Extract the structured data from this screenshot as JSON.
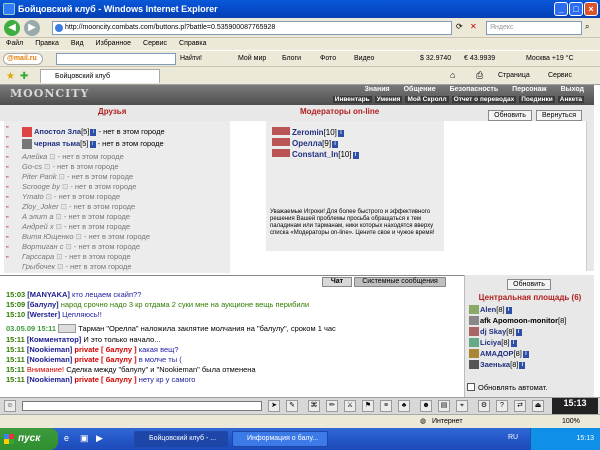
{
  "window": {
    "title": "Бойцовский клуб - Windows Internet Explorer",
    "url": "http://mooncity.combats.com/buttons.pl?battle=0.535900087765928",
    "search_placeholder": "Яндекс"
  },
  "menu": [
    "Файл",
    "Правка",
    "Вид",
    "Избранное",
    "Сервис",
    "Справка"
  ],
  "mailbar": {
    "logo": "@mail.ru",
    "find": "Найти!",
    "items": [
      "Мой мир",
      "Блоги",
      "Фото",
      "Видео"
    ],
    "usd": "$ 32.9740",
    "eur": "€ 43.9939",
    "weather": "Москва +19 °C"
  },
  "favbar": {
    "tab": "Бойцовский клуб",
    "page": "Страница",
    "tools": "Сервис"
  },
  "game": {
    "logo": "MOONCITY",
    "nav_top": [
      "Знания",
      "Общение",
      "Безопасность",
      "Персонаж",
      "Выход"
    ],
    "nav_sub": [
      "Инвентарь",
      "Умения",
      "Мой Скролл",
      "Отчет о переводах",
      "Поединки",
      "Анкета"
    ],
    "friends_title": "Друзья",
    "mods_title": "Модераторы on-line",
    "refresh": "Обновить",
    "back": "Вернуться",
    "friends_online": [
      {
        "name": "Апостол Зла",
        "level": "[5]",
        "status": " - нет в этом городе"
      },
      {
        "name": "черная тьма",
        "level": "[5]",
        "status": " - нет в этом городе"
      }
    ],
    "friends_offline": [
      {
        "name": "Алейка",
        "status": " - нет в этом городе"
      },
      {
        "name": "Go-cs",
        "status": " - нет в этом городе"
      },
      {
        "name": "Piter Pank",
        "status": " - нет в этом городе"
      },
      {
        "name": "Scrooge by",
        "status": " - нет в этом городе"
      },
      {
        "name": "Ymato",
        "status": " - нет в этом городе"
      },
      {
        "name": "Zloy_Joker",
        "status": " - нет в этом городе"
      },
      {
        "name": "А элит а",
        "status": " - нет в этом городе"
      },
      {
        "name": "Андрей х",
        "status": " - нет в этом городе"
      },
      {
        "name": "Витя Ющенко",
        "status": " - нет в этом городе"
      },
      {
        "name": "Вортиган с",
        "status": " - нет в этом городе"
      },
      {
        "name": "Гарссара",
        "status": " - нет в этом городе"
      },
      {
        "name": "Грыбочек",
        "status": " - нет в этом городе"
      }
    ],
    "moderators": [
      {
        "name": "Zeromin",
        "level": "[10]"
      },
      {
        "name": "Орелла",
        "level": "[9]"
      },
      {
        "name": "Constant_In",
        "level": "[10]"
      }
    ],
    "mod_text": "Уважаемые Игроки! Для более быстрого и эффективного решения Вашей проблемы просьба обращаться к тем паладинам или тарманам, ники которых находятся вверху списка «Модераторы on-line». Цените свое и чужое время!",
    "chat_tab": "Чат",
    "system_tab": "Системные сообщения",
    "chat": [
      {
        "time": "15:03",
        "who": "[MANYAKA]",
        "text": " кто лецаем скайп??"
      },
      {
        "time": "15:09",
        "who": "[балулу]",
        "text": " народ срочно надо 3 кр отдама 2 суки мне на аукционе вещь перибили"
      },
      {
        "time": "15:10",
        "who": "[Werster]",
        "text": " Цепляюсь!!"
      },
      {
        "time": "03.05.09 15:11",
        "text": "Тарман \"Орелла\" наложила заклятие молчания на \"балулу\", сроком 1 час"
      },
      {
        "time": "15:11",
        "who": "[Комментатор]",
        "text": " И это только начало..."
      },
      {
        "time": "15:11",
        "who": "[Nookieman]",
        "priv": " private [ балулу ]",
        "text": " какая вещ?"
      },
      {
        "time": "15:11",
        "who": "[Nookieman]",
        "priv": " private [ балулу ]",
        "text": " в молче ты ("
      },
      {
        "time": "15:11",
        "warn": "Внимание!",
        "text": " Сделка между \"балулу\" и \"Nookieman\" была отменена"
      },
      {
        "time": "15:11",
        "who": "[Nookieman]",
        "priv": " private [ балулу ]",
        "text": " нету кр у самого"
      }
    ],
    "room_refresh": "Обновить",
    "room_title": "Центральная площадь (6)",
    "users": [
      {
        "name": "Alen",
        "level": "[8]"
      },
      {
        "name": "afk Apomoon-monitor",
        "level": "[8]"
      },
      {
        "name": "dj Skay",
        "level": "[8]"
      },
      {
        "name": "Liciya",
        "level": "[8]"
      },
      {
        "name": "АМАДОР",
        "level": "[8]"
      },
      {
        "name": "Заенька",
        "level": "[8]"
      }
    ],
    "auto_refresh": "Обновлять автомат.",
    "clock": "15:13"
  },
  "status": {
    "zone": "Интернет",
    "zoom": "100%"
  },
  "taskbar": {
    "start": "пуск",
    "tasks": [
      "Бойцовский клуб - ...",
      "Информация о балу..."
    ],
    "lang": "RU",
    "time": "15:13"
  }
}
